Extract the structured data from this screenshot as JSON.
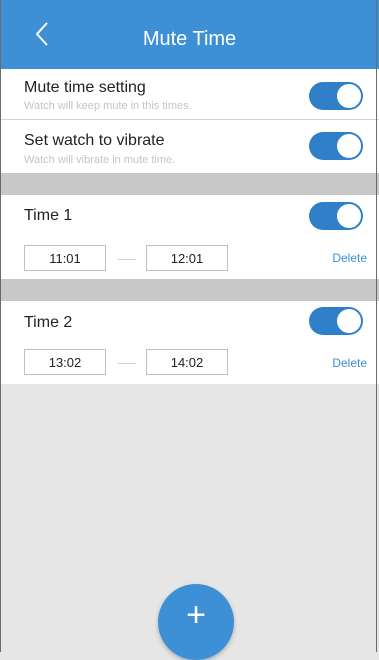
{
  "header": {
    "title": "Mute Time",
    "back_icon": "chevron-left-icon",
    "color": "#3d8fd6"
  },
  "settings": [
    {
      "label": "Mute time setting",
      "sub": "Watch will keep mute in this times.",
      "on": true
    },
    {
      "label": "Set watch to vibrate",
      "sub": "Watch will vibrate in mute time.",
      "on": true
    }
  ],
  "times": [
    {
      "label": "Time 1",
      "start": "11:01",
      "end": "12:01",
      "on": true,
      "delete_label": "Delete"
    },
    {
      "label": "Time 2",
      "start": "13:02",
      "end": "14:02",
      "on": true,
      "delete_label": "Delete"
    }
  ],
  "fab": {
    "icon": "plus-icon",
    "label": "+"
  }
}
